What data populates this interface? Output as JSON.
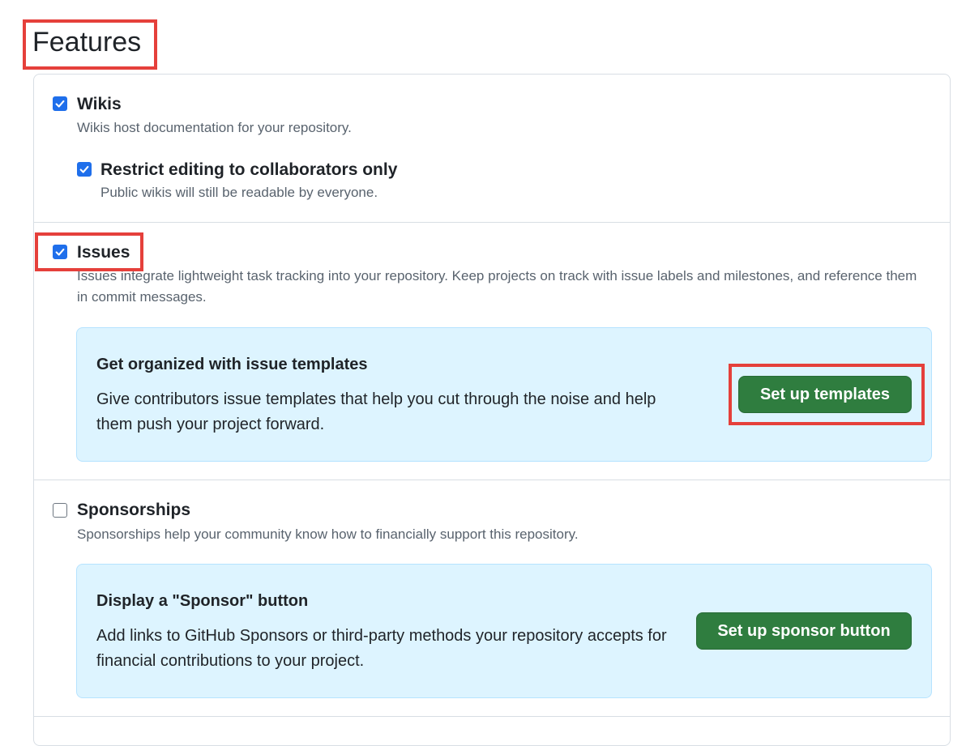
{
  "page": {
    "title": "Features"
  },
  "wikis": {
    "label": "Wikis",
    "checked": true,
    "description": "Wikis host documentation for your repository.",
    "restrict": {
      "label": "Restrict editing to collaborators only",
      "checked": true,
      "description": "Public wikis will still be readable by everyone."
    }
  },
  "issues": {
    "label": "Issues",
    "checked": true,
    "description": "Issues integrate lightweight task tracking into your repository. Keep projects on track with issue labels and milestones, and reference them in commit messages.",
    "callout": {
      "title": "Get organized with issue templates",
      "text": "Give contributors issue templates that help you cut through the noise and help them push your project forward.",
      "button": "Set up templates"
    }
  },
  "sponsorships": {
    "label": "Sponsorships",
    "checked": false,
    "description": "Sponsorships help your community know how to financially support this repository.",
    "callout": {
      "title": "Display a \"Sponsor\" button",
      "text": "Add links to GitHub Sponsors or third-party methods your repository accepts for financial contributions to your project.",
      "button": "Set up sponsor button"
    }
  },
  "colors": {
    "highlight": "#e5403b",
    "checkbox": "#1f6feb",
    "button": "#2f7d3f",
    "callout_bg": "#ddf4ff"
  }
}
